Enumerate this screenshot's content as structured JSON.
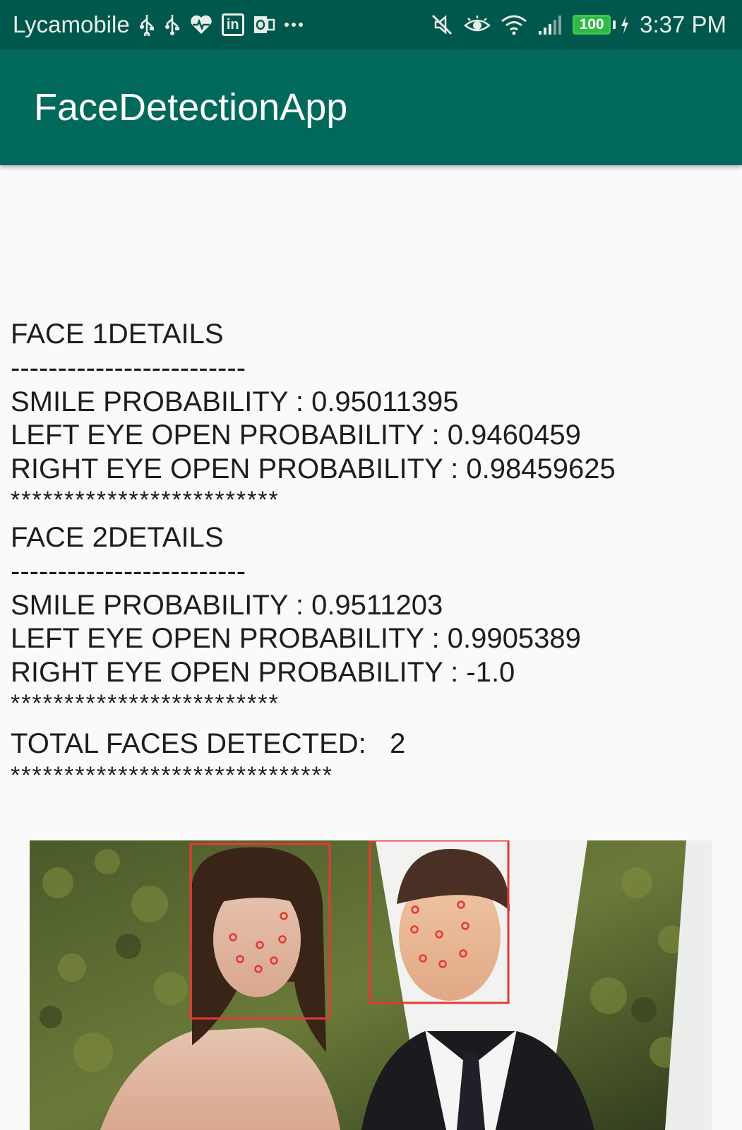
{
  "status_bar": {
    "carrier": "Lycamobile",
    "battery": "100",
    "time": "3:37 PM",
    "icons_left": [
      "usb-icon",
      "usb-icon",
      "health-icon",
      "linkedin-icon",
      "outlook-icon",
      "more-icon"
    ],
    "icons_right": [
      "mute-icon",
      "eye-icon",
      "wifi-icon",
      "signal-icon",
      "battery-icon",
      "charging-icon"
    ]
  },
  "app_bar": {
    "title": "FaceDetectionApp"
  },
  "results": {
    "face1": {
      "header": "FACE 1DETAILS",
      "dashes": "-------------------------",
      "smile": "SMILE PROBABILITY : 0.95011395",
      "left_eye": "LEFT EYE OPEN PROBABILITY : 0.9460459",
      "right_eye": "RIGHT EYE OPEN PROBABILITY : 0.98459625",
      "stars": "*************************"
    },
    "face2": {
      "header": "FACE 2DETAILS",
      "dashes": "-------------------------",
      "smile": "SMILE PROBABILITY : 0.9511203",
      "left_eye": "LEFT EYE OPEN PROBABILITY : 0.9905389",
      "right_eye": "RIGHT EYE OPEN PROBABILITY : -1.0",
      "stars": "*************************"
    },
    "total": "TOTAL FACES DETECTED:   2",
    "total_stars": "******************************"
  },
  "colors": {
    "status_bar": "#00574b",
    "app_bar": "#00695c",
    "face_box": "#e53935",
    "background": "#fafafa"
  }
}
